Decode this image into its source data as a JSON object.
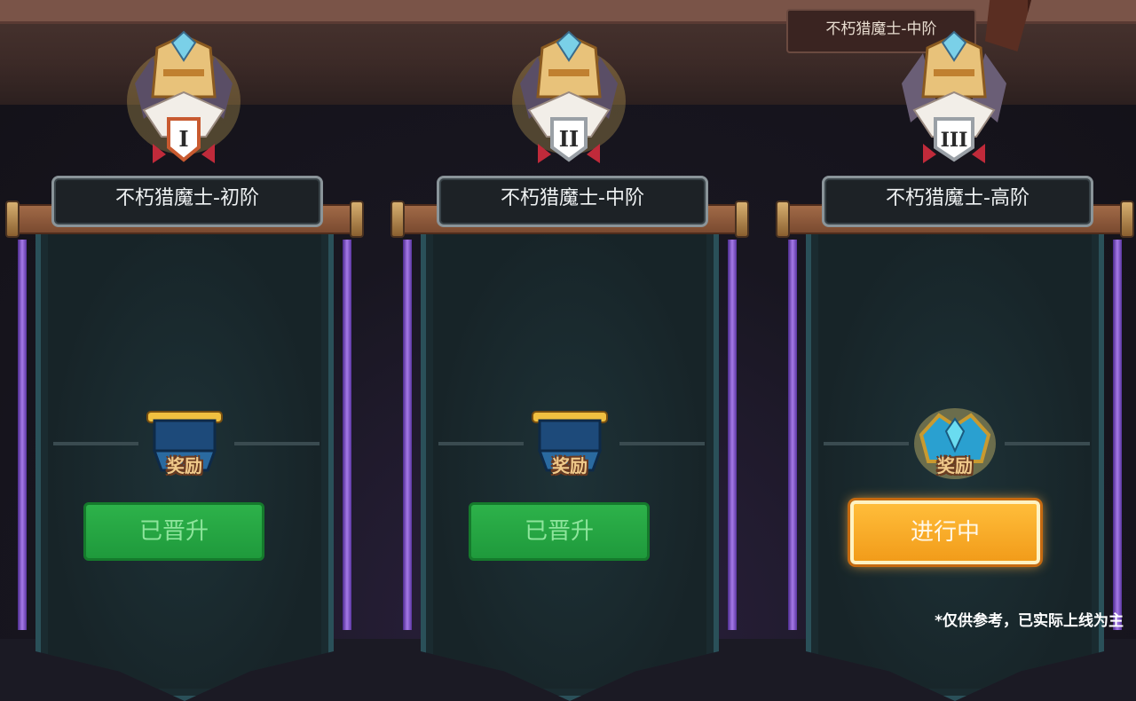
{
  "top_label": "不朽猎魔士-中阶",
  "cards": [
    {
      "numeral": "I",
      "title": "不朽猎魔士-初阶",
      "reward_label": "奖励",
      "button_label": "已晋升",
      "state": "done"
    },
    {
      "numeral": "II",
      "title": "不朽猎魔士-中阶",
      "reward_label": "奖励",
      "button_label": "已晋升",
      "state": "done"
    },
    {
      "numeral": "III",
      "title": "不朽猎魔士-高阶",
      "reward_label": "奖励",
      "button_label": "进行中",
      "state": "in-progress"
    }
  ],
  "footnote": "*仅供参考，已实际上线为主",
  "colors": {
    "done_button": "#2db24a",
    "active_button": "#f7a928",
    "banner": "#1a2b30",
    "pole": "#a67ae8"
  }
}
